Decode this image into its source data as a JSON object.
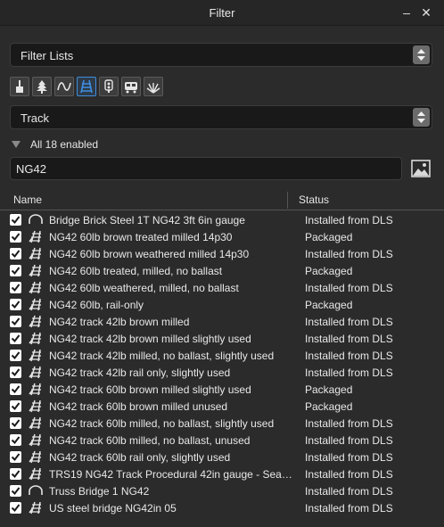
{
  "window": {
    "title": "Filter",
    "minimize_glyph": "–",
    "close_glyph": "✕"
  },
  "filter_lists": {
    "label": "Filter Lists"
  },
  "toolbar": {
    "tools": [
      {
        "icon": "paintbrush-icon",
        "active": false
      },
      {
        "icon": "tree-icon",
        "active": false
      },
      {
        "icon": "spline-icon",
        "active": false
      },
      {
        "icon": "track-icon",
        "active": true
      },
      {
        "icon": "signal-icon",
        "active": false
      },
      {
        "icon": "train-icon",
        "active": false
      },
      {
        "icon": "grass-icon",
        "active": false
      }
    ]
  },
  "category": {
    "label": "Track"
  },
  "summary": {
    "text": "All 18 enabled"
  },
  "search": {
    "value": "NG42",
    "placeholder": ""
  },
  "table": {
    "headers": {
      "name": "Name",
      "status": "Status"
    },
    "rows": [
      {
        "checked": true,
        "icon": "bridge-icon",
        "name": "Bridge Brick Steel 1T NG42 3ft 6in gauge",
        "status": "Installed from DLS"
      },
      {
        "checked": true,
        "icon": "track-icon",
        "name": "NG42 60lb brown treated milled 14p30",
        "status": "Packaged"
      },
      {
        "checked": true,
        "icon": "track-icon",
        "name": "NG42 60lb brown weathered milled 14p30",
        "status": "Installed from DLS"
      },
      {
        "checked": true,
        "icon": "track-icon",
        "name": "NG42 60lb treated, milled, no ballast",
        "status": "Packaged"
      },
      {
        "checked": true,
        "icon": "track-icon",
        "name": "NG42 60lb weathered, milled, no ballast",
        "status": "Installed from DLS"
      },
      {
        "checked": true,
        "icon": "track-icon",
        "name": "NG42 60lb, rail-only",
        "status": "Packaged"
      },
      {
        "checked": true,
        "icon": "track-icon",
        "name": "NG42 track 42lb brown milled",
        "status": "Installed from DLS"
      },
      {
        "checked": true,
        "icon": "track-icon",
        "name": "NG42 track 42lb brown milled slightly used",
        "status": "Installed from DLS"
      },
      {
        "checked": true,
        "icon": "track-icon",
        "name": "NG42 track 42lb milled, no ballast, slightly used",
        "status": "Installed from DLS"
      },
      {
        "checked": true,
        "icon": "track-icon",
        "name": "NG42 track 42lb rail only, slightly used",
        "status": "Installed from DLS"
      },
      {
        "checked": true,
        "icon": "track-icon",
        "name": "NG42 track 60lb brown milled slightly used",
        "status": "Packaged"
      },
      {
        "checked": true,
        "icon": "track-icon",
        "name": "NG42 track 60lb brown milled unused",
        "status": "Packaged"
      },
      {
        "checked": true,
        "icon": "track-icon",
        "name": "NG42 track 60lb milled, no ballast, slightly used",
        "status": "Installed from DLS"
      },
      {
        "checked": true,
        "icon": "track-icon",
        "name": "NG42 track 60lb milled, no ballast, unused",
        "status": "Installed from DLS"
      },
      {
        "checked": true,
        "icon": "track-icon",
        "name": "NG42 track 60lb rail only, slightly used",
        "status": "Installed from DLS"
      },
      {
        "checked": true,
        "icon": "track-icon",
        "name": "TRS19 NG42 Track Procedural 42in gauge - Seaso...",
        "status": "Installed from DLS"
      },
      {
        "checked": true,
        "icon": "bridge-icon",
        "name": "Truss Bridge 1 NG42",
        "status": "Installed from DLS"
      },
      {
        "checked": true,
        "icon": "track-icon",
        "name": "US steel bridge NG42in 05",
        "status": "Installed from DLS"
      }
    ]
  },
  "colors": {
    "accent": "#3f8fe0",
    "background": "#2b2b2b",
    "field": "#191919"
  }
}
